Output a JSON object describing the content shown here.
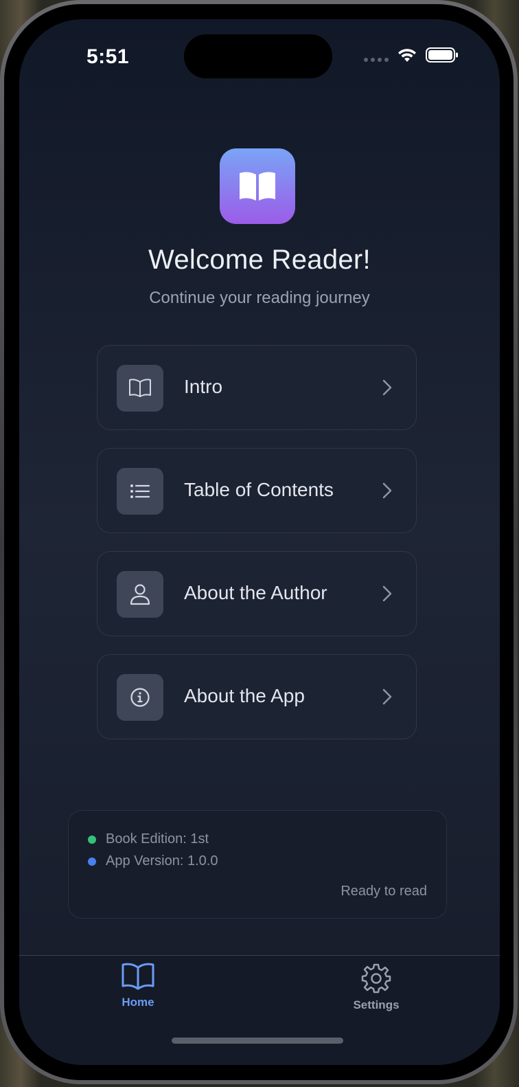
{
  "status_bar": {
    "time": "5:51",
    "icons": [
      "cellular-dots-icon",
      "wifi-icon",
      "battery-icon"
    ]
  },
  "header": {
    "logo_icon": "open-book-icon",
    "title": "Welcome Reader!",
    "subtitle": "Continue your reading journey"
  },
  "menu": {
    "items": [
      {
        "label": "Intro",
        "icon": "open-book-outline-icon"
      },
      {
        "label": "Table of Contents",
        "icon": "list-icon"
      },
      {
        "label": "About the Author",
        "icon": "person-icon"
      },
      {
        "label": "About the App",
        "icon": "info-circle-icon"
      }
    ]
  },
  "info": {
    "edition": "Book Edition: 1st",
    "version": "App Version: 1.0.0",
    "status": "Ready to read",
    "edition_dot_color": "#34c17a",
    "version_dot_color": "#4a7ff0"
  },
  "tabs": {
    "home": {
      "label": "Home",
      "icon": "book-icon",
      "active": true
    },
    "settings": {
      "label": "Settings",
      "icon": "gear-icon",
      "active": false
    }
  },
  "colors": {
    "accent": "#6a9cf5",
    "inactive": "#9aa0ac"
  }
}
